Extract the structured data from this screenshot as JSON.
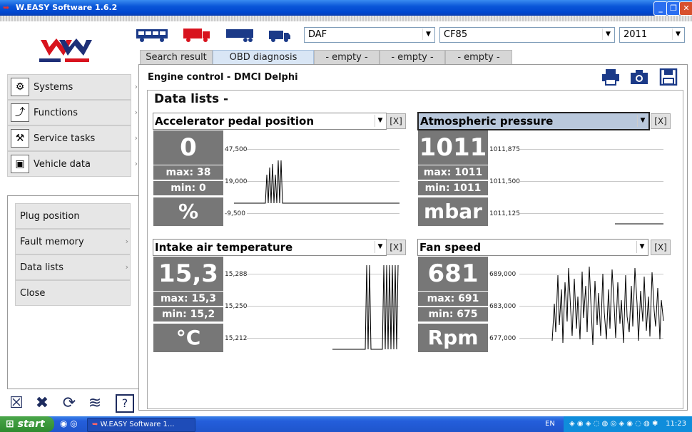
{
  "window": {
    "title": "W.EASY Software 1.6.2"
  },
  "vehicle": {
    "make": "DAF",
    "model": "CF85",
    "year": "2011"
  },
  "tabs": [
    {
      "label": "Search result"
    },
    {
      "label": "OBD diagnosis"
    },
    {
      "label": "- empty -"
    },
    {
      "label": "- empty -"
    },
    {
      "label": "- empty -"
    }
  ],
  "sidebar": {
    "items": [
      {
        "label": "Systems"
      },
      {
        "label": "Functions"
      },
      {
        "label": "Service tasks"
      },
      {
        "label": "Vehicle data"
      }
    ],
    "subitems": [
      {
        "label": "Plug position"
      },
      {
        "label": "Fault memory"
      },
      {
        "label": "Data lists"
      },
      {
        "label": "Close"
      }
    ]
  },
  "main": {
    "title": "Engine control - DMCI Delphi",
    "section_title": "Data lists -",
    "close_label": "[X]"
  },
  "panels": [
    {
      "name": "Accelerator pedal position",
      "value": "0",
      "max": "max: 38",
      "min": "min: 0",
      "unit": "%",
      "ticks": [
        "47,500",
        "19,000",
        "-9,500"
      ]
    },
    {
      "name": "Atmospheric pressure",
      "value": "1011",
      "max": "max: 1011",
      "min": "min: 1011",
      "unit": "mbar",
      "ticks": [
        "1011,875",
        "1011,500",
        "1011,125"
      ]
    },
    {
      "name": "Intake air temperature",
      "value": "15,3",
      "max": "max: 15,3",
      "min": "min: 15,2",
      "unit": "°C",
      "ticks": [
        "15,288",
        "15,250",
        "15,212"
      ]
    },
    {
      "name": "Fan speed",
      "value": "681",
      "max": "max: 691",
      "min": "min: 675",
      "unit": "Rpm",
      "ticks": [
        "689,000",
        "683,000",
        "677,000"
      ]
    }
  ],
  "taskbar": {
    "start": "start",
    "app": "W.EASY Software 1...",
    "lang": "EN",
    "clock": "11:23"
  }
}
